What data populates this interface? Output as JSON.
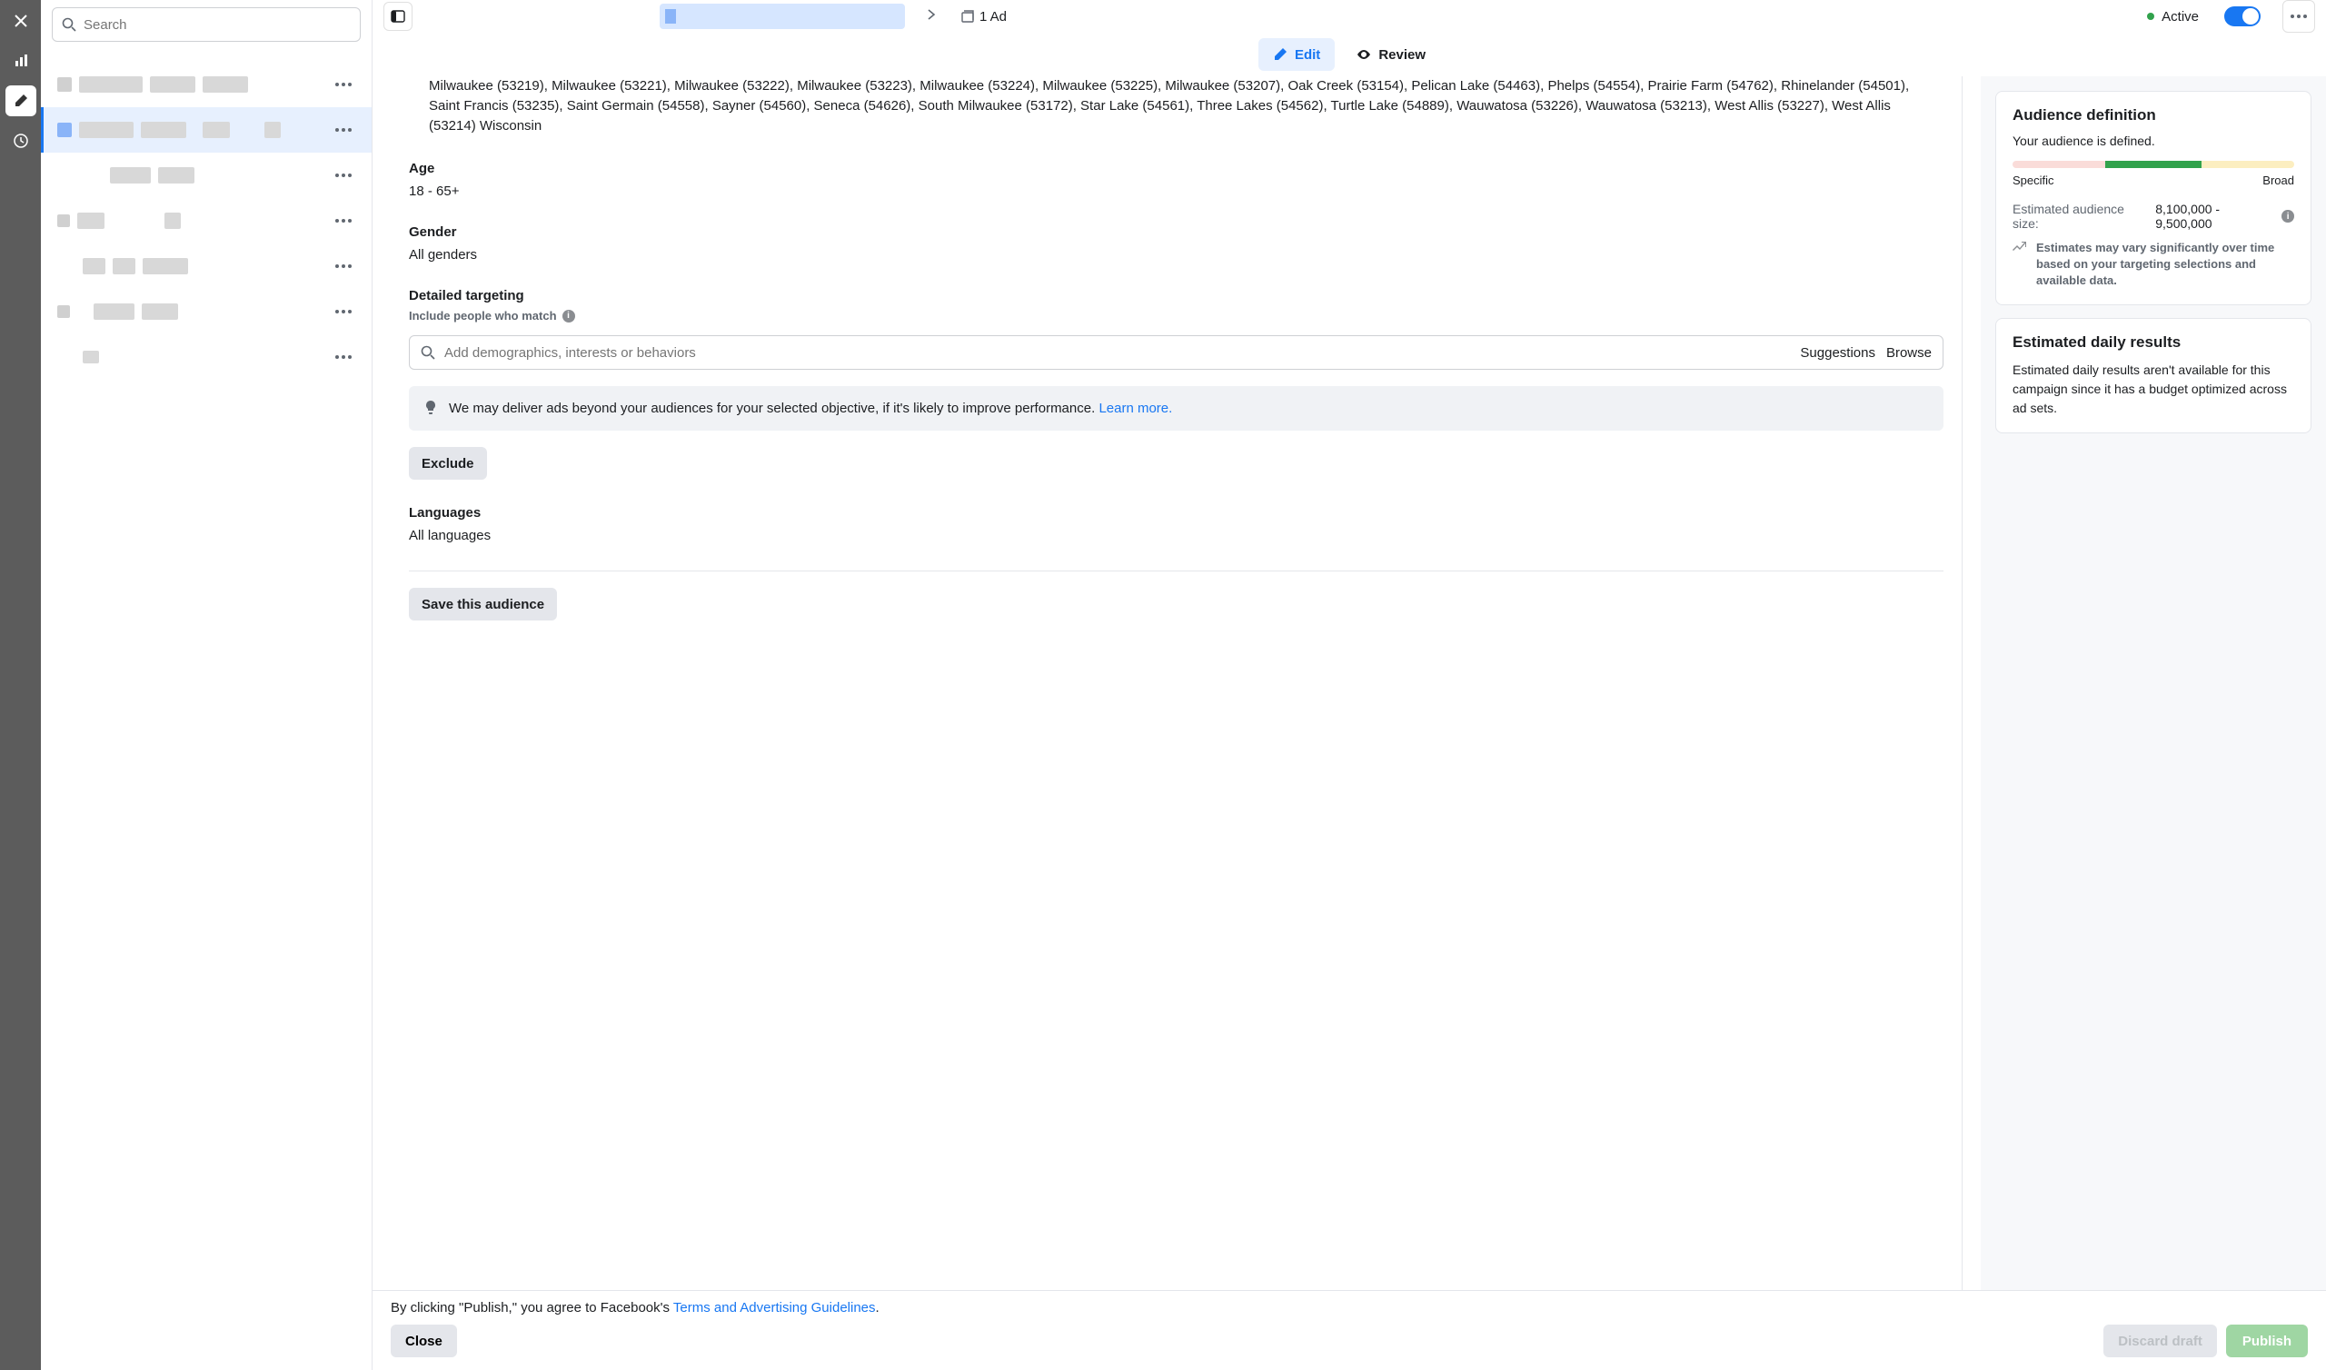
{
  "search": {
    "placeholder": "Search"
  },
  "header": {
    "ad_count": "1 Ad",
    "status": "Active"
  },
  "tabs": {
    "edit": "Edit",
    "review": "Review"
  },
  "fields": {
    "location_text": "Milwaukee (53219), Milwaukee (53221), Milwaukee (53222), Milwaukee (53223), Milwaukee (53224), Milwaukee (53225), Milwaukee (53207), Oak Creek (53154), Pelican Lake (54463), Phelps (54554), Prairie Farm (54762), Rhinelander (54501), Saint Francis (53235), Saint Germain (54558), Sayner (54560), Seneca (54626), South Milwaukee (53172), Star Lake (54561), Three Lakes (54562), Turtle Lake (54889), Wauwatosa (53226), Wauwatosa (53213), West Allis (53227), West Allis (53214) Wisconsin",
    "age_label": "Age",
    "age_value": "18 - 65+",
    "gender_label": "Gender",
    "gender_value": "All genders",
    "targeting_label": "Detailed targeting",
    "targeting_hint": "Include people who match",
    "targeting_placeholder": "Add demographics, interests or behaviors",
    "suggestions": "Suggestions",
    "browse": "Browse",
    "delivery_note": "We may deliver ads beyond your audiences for your selected objective, if it's likely to improve performance. ",
    "learn_more": "Learn more.",
    "exclude": "Exclude",
    "languages_label": "Languages",
    "languages_value": "All languages",
    "save_audience": "Save this audience"
  },
  "right": {
    "definition_title": "Audience definition",
    "defined_text": "Your audience is defined.",
    "specific": "Specific",
    "broad": "Broad",
    "est_label": "Estimated audience size:",
    "est_value": "8,100,000 - 9,500,000",
    "est_warn": "Estimates may vary significantly over time based on your targeting selections and available data.",
    "daily_title": "Estimated daily results",
    "daily_text": "Estimated daily results aren't available for this campaign since it has a budget optimized across ad sets."
  },
  "footer": {
    "legal_prefix": "By clicking \"Publish,\" you agree to Facebook's ",
    "legal_link": "Terms and Advertising Guidelines",
    "close": "Close",
    "discard": "Discard draft",
    "publish": "Publish"
  }
}
